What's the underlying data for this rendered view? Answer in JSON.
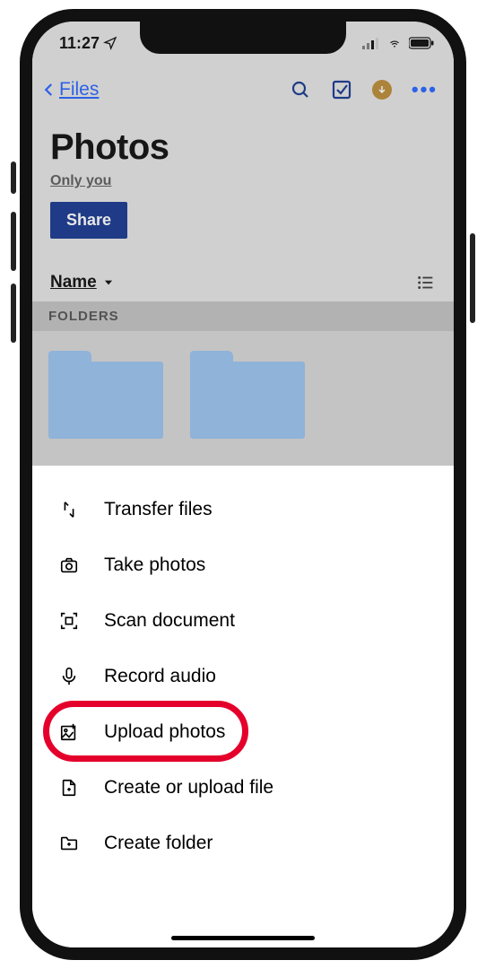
{
  "status": {
    "time": "11:27"
  },
  "nav": {
    "back_label": "Files"
  },
  "header": {
    "title": "Photos",
    "subtitle": "Only you",
    "share_label": "Share"
  },
  "sort": {
    "label": "Name"
  },
  "section": {
    "folders_label": "FOLDERS"
  },
  "menu": {
    "items": [
      {
        "label": "Transfer files"
      },
      {
        "label": "Take photos"
      },
      {
        "label": "Scan document"
      },
      {
        "label": "Record audio"
      },
      {
        "label": "Upload photos"
      },
      {
        "label": "Create or upload file"
      },
      {
        "label": "Create folder"
      }
    ]
  },
  "highlight_index": 4
}
